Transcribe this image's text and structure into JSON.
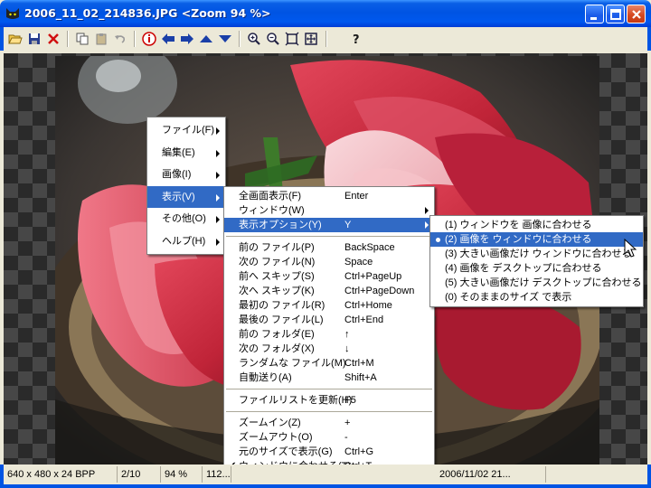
{
  "window": {
    "title": "2006_11_02_214836.JPG <Zoom 94 %>"
  },
  "toolbar": {
    "buttons": [
      "open-folder-icon",
      "save-icon",
      "delete-icon",
      "copy-icon",
      "paste-icon",
      "undo-icon",
      "info-icon",
      "previous-arrow-icon",
      "next-arrow-icon",
      "up-arrow-icon",
      "down-arrow-icon",
      "zoom-in-icon",
      "zoom-out-icon",
      "fit-window-icon",
      "actual-size-icon",
      "help-icon"
    ]
  },
  "context_menu": {
    "items": [
      {
        "label": "ファイル(F)",
        "has_submenu": true
      },
      {
        "label": "編集(E)",
        "has_submenu": true
      },
      {
        "label": "画像(I)",
        "has_submenu": true
      },
      {
        "label": "表示(V)",
        "has_submenu": true,
        "highlighted": true
      },
      {
        "label": "その他(O)",
        "has_submenu": true
      },
      {
        "label": "ヘルプ(H)",
        "has_submenu": true
      }
    ]
  },
  "view_menu": {
    "groups": [
      [
        {
          "label": "全画面表示(F)",
          "shortcut": "Enter"
        },
        {
          "label": "ウィンドウ(W)",
          "shortcut": "",
          "has_submenu": true
        },
        {
          "label": "表示オプション(Y)",
          "shortcut": "Y",
          "has_submenu": true,
          "highlighted": true
        }
      ],
      [
        {
          "label": "前の ファイル(P)",
          "shortcut": "BackSpace"
        },
        {
          "label": "次の ファイル(N)",
          "shortcut": "Space"
        },
        {
          "label": "前へ スキップ(S)",
          "shortcut": "Ctrl+PageUp"
        },
        {
          "label": "次へ スキップ(K)",
          "shortcut": "Ctrl+PageDown"
        },
        {
          "label": "最初の ファイル(R)",
          "shortcut": "Ctrl+Home"
        },
        {
          "label": "最後の ファイル(L)",
          "shortcut": "Ctrl+End"
        },
        {
          "label": "前の フォルダ(E)",
          "shortcut": "↑"
        },
        {
          "label": "次の フォルダ(X)",
          "shortcut": "↓"
        },
        {
          "label": "ランダムな ファイル(M)",
          "shortcut": "Ctrl+M"
        },
        {
          "label": "自動送り(A)",
          "shortcut": "Shift+A"
        }
      ],
      [
        {
          "label": "ファイルリストを更新(H)",
          "shortcut": "F5"
        }
      ],
      [
        {
          "label": "ズームイン(Z)",
          "shortcut": "+"
        },
        {
          "label": "ズームアウト(O)",
          "shortcut": "-"
        },
        {
          "label": "元のサイズで表示(G)",
          "shortcut": "Ctrl+G"
        },
        {
          "label": "ウィンドウに合わせる(T)",
          "shortcut": "Ctrl+T",
          "checked": true
        }
      ]
    ]
  },
  "display_options_menu": {
    "items": [
      {
        "label": "(1) ウィンドウを 画像に合わせる"
      },
      {
        "label": "(2) 画像を ウィンドウに合わせる",
        "selected": true
      },
      {
        "label": "(3) 大きい画像だけ ウィンドウに合わせる"
      },
      {
        "label": "(4) 画像を デスクトップに合わせる"
      },
      {
        "label": "(5) 大きい画像だけ デスクトップに合わせる"
      },
      {
        "label": "(0) そのままのサイズ で表示"
      }
    ]
  },
  "statusbar": {
    "dimensions": "640 x 480 x 24 BPP",
    "position": "2/10",
    "zoom": "94 %",
    "file_size": "112...",
    "date": "2006/11/02 21..."
  },
  "colors": {
    "titlebar": "#0054e3",
    "highlight": "#316ac5",
    "face": "#ece9d8"
  }
}
